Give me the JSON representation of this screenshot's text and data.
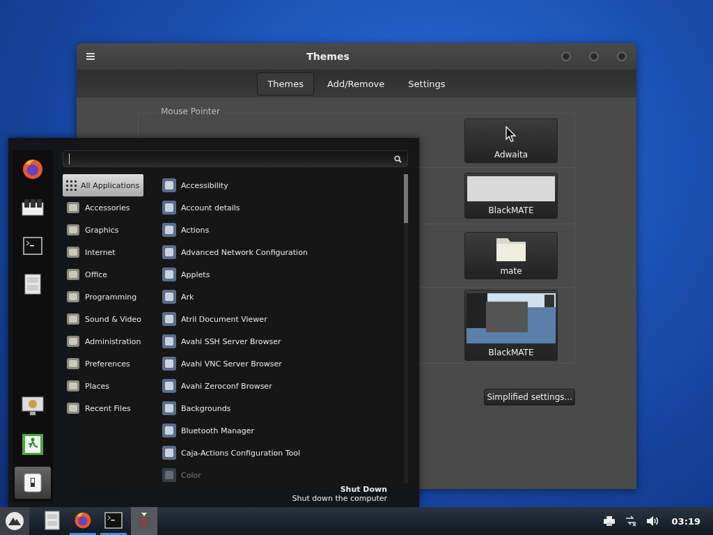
{
  "window": {
    "title": "Themes"
  },
  "tabs": [
    {
      "label": "Themes",
      "selected": true
    },
    {
      "label": "Add/Remove",
      "selected": false
    },
    {
      "label": "Settings",
      "selected": false
    }
  ],
  "theme_rows": [
    {
      "label": "Mouse Pointer",
      "kind": "cursor",
      "name": "Adwaita"
    },
    {
      "kind": "color",
      "name": "BlackMATE"
    },
    {
      "kind": "folder",
      "name": "mate"
    },
    {
      "kind": "screenshot",
      "name": "BlackMATE"
    }
  ],
  "simplified_button": "Simplified settings...",
  "menu": {
    "favorites": [
      {
        "kind": "firefox",
        "selected": false
      },
      {
        "kind": "settings",
        "selected": false
      },
      {
        "kind": "terminal",
        "selected": false
      },
      {
        "kind": "files",
        "selected": false
      }
    ],
    "session": [
      {
        "kind": "lock",
        "selected": false
      },
      {
        "kind": "logout",
        "selected": false
      },
      {
        "kind": "shutdown",
        "selected": true
      }
    ],
    "categories": [
      {
        "label": "All Applications",
        "selected": true
      },
      {
        "label": "Accessories",
        "selected": false
      },
      {
        "label": "Graphics",
        "selected": false
      },
      {
        "label": "Internet",
        "selected": false
      },
      {
        "label": "Office",
        "selected": false
      },
      {
        "label": "Programming",
        "selected": false
      },
      {
        "label": "Sound & Video",
        "selected": false
      },
      {
        "label": "Administration",
        "selected": false
      },
      {
        "label": "Preferences",
        "selected": false
      },
      {
        "label": "Places",
        "selected": false
      },
      {
        "label": "Recent Files",
        "selected": false
      }
    ],
    "apps": [
      {
        "label": "Accessibility",
        "dimmed": false
      },
      {
        "label": "Account details",
        "dimmed": false
      },
      {
        "label": "Actions",
        "dimmed": false
      },
      {
        "label": "Advanced Network Configuration",
        "dimmed": false
      },
      {
        "label": "Applets",
        "dimmed": false
      },
      {
        "label": "Ark",
        "dimmed": false
      },
      {
        "label": "Atril Document Viewer",
        "dimmed": false
      },
      {
        "label": "Avahi SSH Server Browser",
        "dimmed": false
      },
      {
        "label": "Avahi VNC Server Browser",
        "dimmed": false
      },
      {
        "label": "Avahi Zeroconf Browser",
        "dimmed": false
      },
      {
        "label": "Backgrounds",
        "dimmed": false
      },
      {
        "label": "Bluetooth Manager",
        "dimmed": false
      },
      {
        "label": "Caja-Actions Configuration Tool",
        "dimmed": false
      },
      {
        "label": "Color",
        "dimmed": true
      }
    ],
    "tooltip": {
      "title": "Shut Down",
      "text": "Shut down the computer"
    }
  },
  "taskbar": {
    "apps": [
      {
        "kind": "files",
        "running": false,
        "active": false
      },
      {
        "kind": "firefox",
        "running": true,
        "active": false
      },
      {
        "kind": "terminal",
        "running": true,
        "active": false
      },
      {
        "kind": "themes",
        "running": false,
        "active": true
      }
    ],
    "clock": "03:19"
  }
}
